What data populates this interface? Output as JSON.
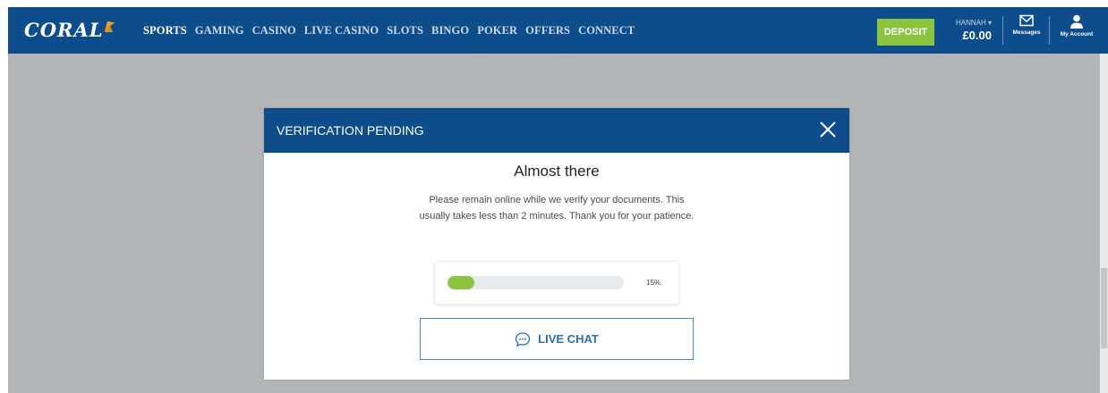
{
  "brand": {
    "name": "CORAL"
  },
  "nav": {
    "items": [
      {
        "label": "SPORTS",
        "active": true
      },
      {
        "label": "GAMING",
        "active": false
      },
      {
        "label": "CASINO",
        "active": false
      },
      {
        "label": "LIVE CASINO",
        "active": false
      },
      {
        "label": "SLOTS",
        "active": false
      },
      {
        "label": "BINGO",
        "active": false
      },
      {
        "label": "POKER",
        "active": false
      },
      {
        "label": "OFFERS",
        "active": false
      },
      {
        "label": "CONNECT",
        "active": false
      }
    ]
  },
  "header": {
    "deposit_label": "DEPOSIT",
    "user_name": "HANNAH ▾",
    "balance": "£0.00",
    "messages_label": "Messages",
    "account_label": "My Account"
  },
  "modal": {
    "title": "VERIFICATION PENDING",
    "heading": "Almost there",
    "message": "Please remain online while we verify your documents. This usually takes less than 2 minutes. Thank you for your patience.",
    "progress_text": "15%",
    "progress_value": 0.15,
    "live_chat_label": "LIVE CHAT"
  },
  "colors": {
    "brand_blue": "#0d4d8c",
    "deposit_green": "#8bc53f",
    "progress_green": "#8bc53f",
    "chat_blue": "#2a6fb5",
    "backdrop": "#b3b5b7"
  },
  "icons": {
    "close": "close-icon",
    "messages": "envelope-icon",
    "account": "user-icon",
    "chat": "chat-bubble-icon"
  }
}
